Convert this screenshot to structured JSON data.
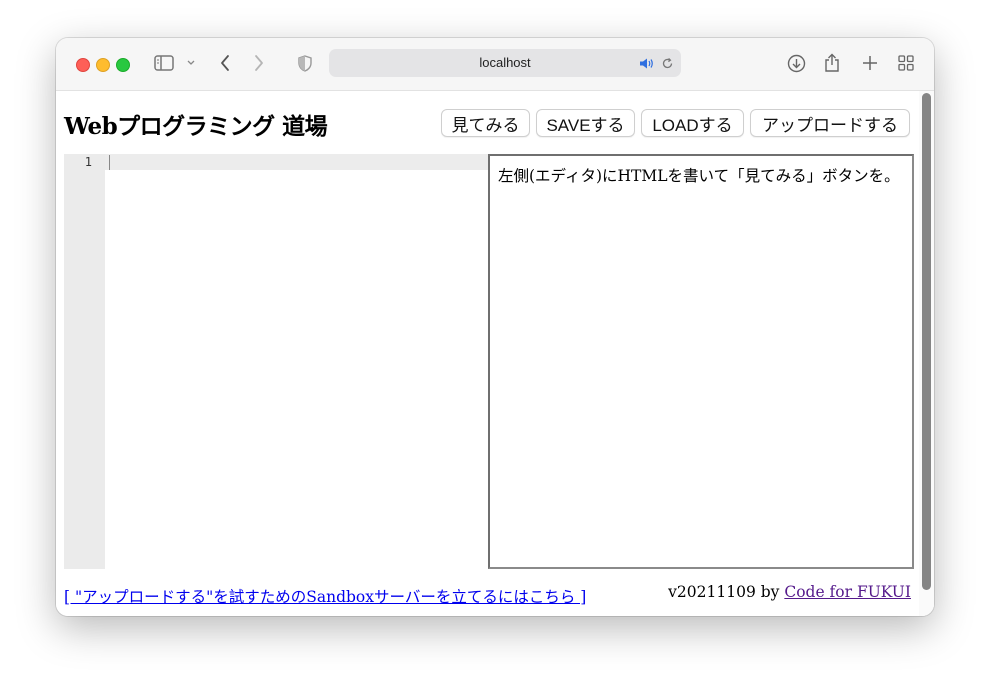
{
  "browser": {
    "address": "localhost",
    "buttons": {
      "sidebar": "sidebar-toggle",
      "back": "back",
      "forward": "forward",
      "downloads": "downloads",
      "share": "share",
      "new_tab": "new-tab",
      "tab_overview": "tab-overview"
    }
  },
  "page": {
    "title": "Webプログラミング 道場",
    "buttons": {
      "view": "見てみる",
      "save": "SAVEする",
      "load": "LOADする",
      "upload": "アップロードする"
    },
    "editor": {
      "line_numbers": [
        "1"
      ]
    },
    "preview_text": "左側(エディタ)にHTMLを書いて「見てみる」ボタンを。",
    "footer": {
      "sandbox_link": "[ \"アップロードする\"を試すためのSandboxサーバーを立てるにはこちら ]",
      "version_prefix": "v20211109 by ",
      "credit_link": "Code for FUKUI"
    }
  },
  "colors": {
    "traffic_red": "#fe5f57",
    "traffic_yellow": "#febc2e",
    "traffic_green": "#28c840",
    "link": "#0000ee",
    "visited_link": "#551a8b",
    "audio_icon": "#2f6fe0"
  }
}
